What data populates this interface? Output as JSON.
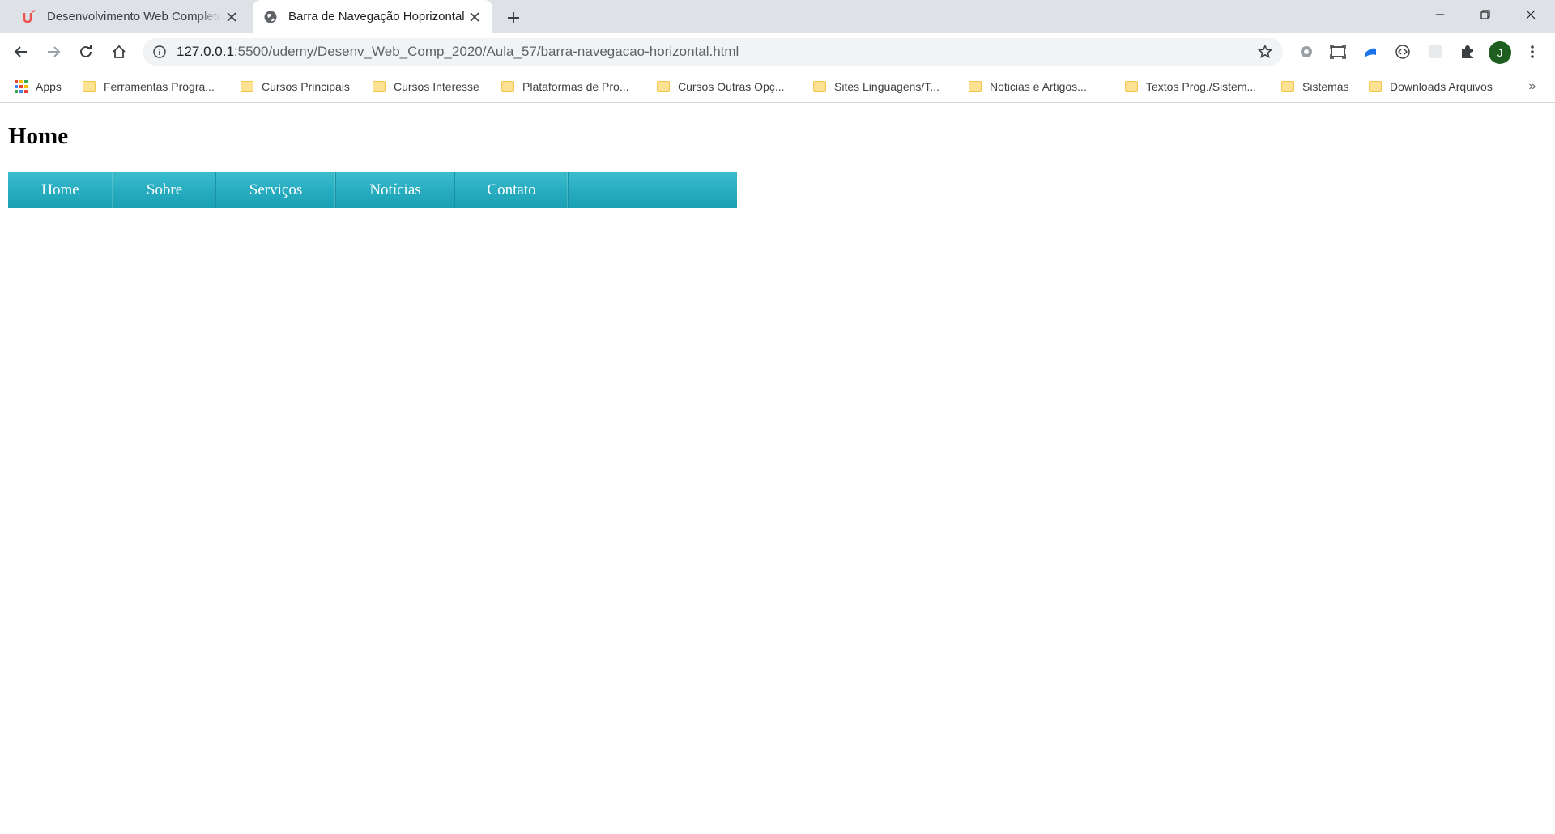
{
  "browser": {
    "tabs": [
      {
        "title": "Desenvolvimento Web Completo",
        "favicon": "udemy-icon",
        "active": false
      },
      {
        "title": "Barra de Navegação Hoprizontal",
        "favicon": "globe-icon",
        "active": true
      }
    ],
    "address": {
      "host": "127.0.0.1",
      "path": ":5500/udemy/Desenv_Web_Comp_2020/Aula_57/barra-navegacao-horizontal.html"
    },
    "profile_initial": "J",
    "bookmarks": [
      {
        "label": "Apps",
        "icon": "apps-grid-icon"
      },
      {
        "label": "Ferramentas Progra...",
        "icon": "folder-icon"
      },
      {
        "label": "Cursos Principais",
        "icon": "folder-icon"
      },
      {
        "label": "Cursos Interesse",
        "icon": "folder-icon"
      },
      {
        "label": "Plataformas de Pro...",
        "icon": "folder-icon"
      },
      {
        "label": "Cursos Outras Opç...",
        "icon": "folder-icon"
      },
      {
        "label": "Sites Linguagens/T...",
        "icon": "folder-icon"
      },
      {
        "label": "Noticias e Artigos...",
        "icon": "folder-icon"
      },
      {
        "label": "Textos Prog./Sistem...",
        "icon": "folder-icon"
      },
      {
        "label": "Sistemas",
        "icon": "folder-icon"
      },
      {
        "label": "Downloads Arquivos",
        "icon": "folder-icon"
      }
    ],
    "more_bookmarks": "»"
  },
  "page": {
    "heading": "Home",
    "nav": [
      {
        "label": "Home"
      },
      {
        "label": "Sobre"
      },
      {
        "label": "Serviços"
      },
      {
        "label": "Notícias"
      },
      {
        "label": "Contato"
      }
    ],
    "colors": {
      "nav_background": "#26abbf",
      "nav_text": "#ffffff"
    }
  }
}
